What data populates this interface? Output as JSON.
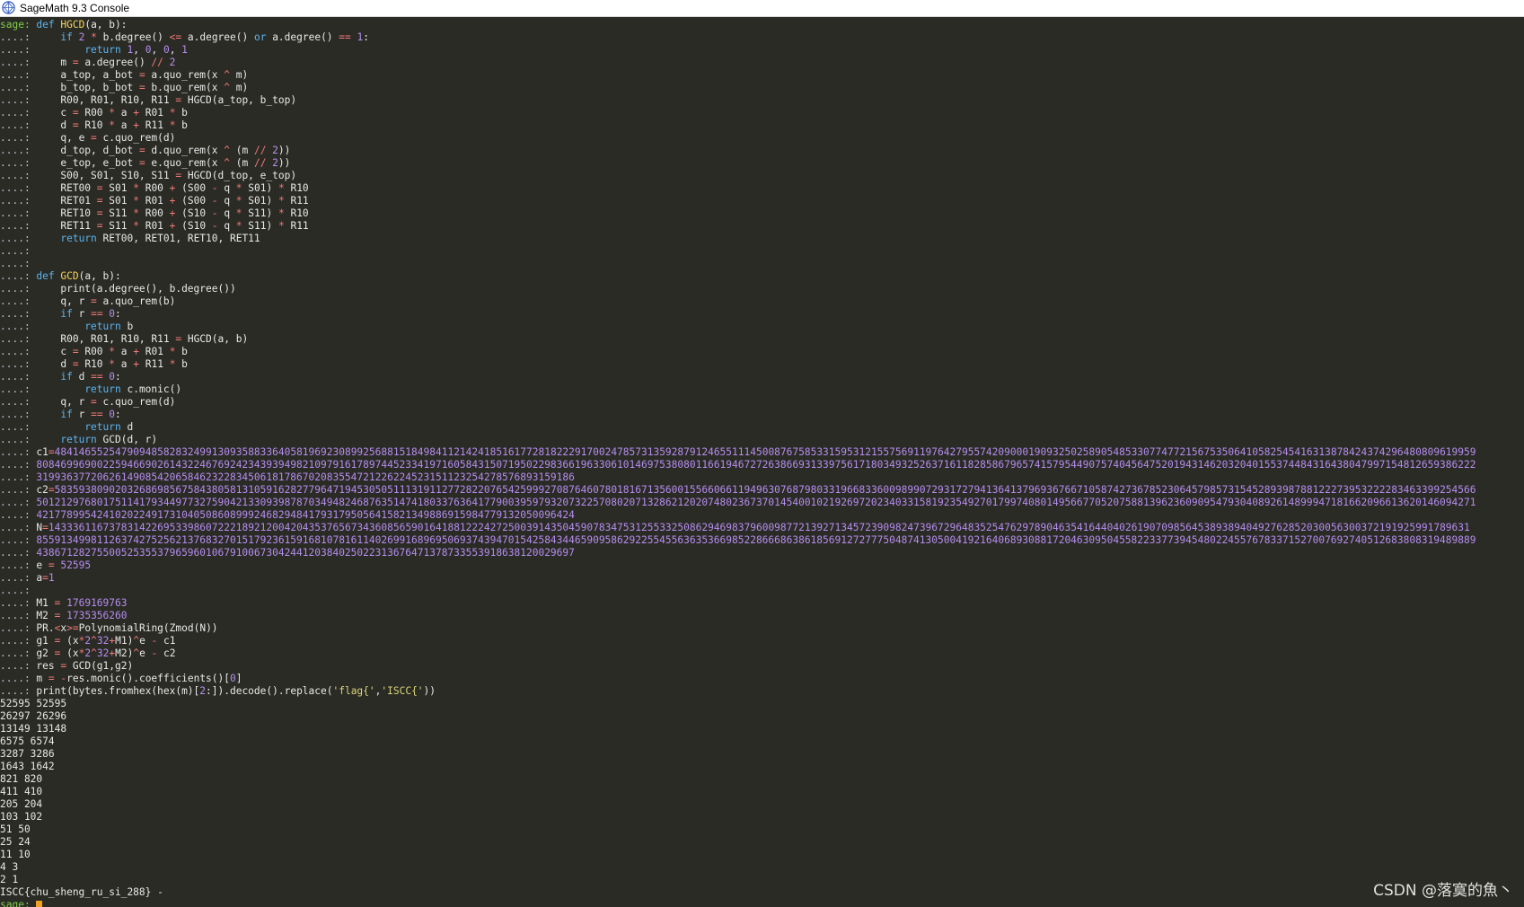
{
  "window": {
    "title": "SageMath 9.3 Console",
    "icon": "sagemath-logo-icon"
  },
  "prompt": {
    "sage": "sage: ",
    "cont": "....: "
  },
  "code_lines": [
    [
      [
        "sp",
        "sage: "
      ],
      [
        "kw",
        "def "
      ],
      [
        "fn",
        "HGCD"
      ],
      [
        "",
        "(a, b):"
      ]
    ],
    [
      [
        "p",
        "....: "
      ],
      [
        "",
        "    "
      ],
      [
        "kw",
        "if "
      ],
      [
        "num",
        "2 "
      ],
      [
        "op",
        "* "
      ],
      [
        "",
        "b.degree() "
      ],
      [
        "op",
        "<= "
      ],
      [
        "",
        "a.degree() "
      ],
      [
        "kw",
        "or "
      ],
      [
        "",
        "a.degree() "
      ],
      [
        "op",
        "== "
      ],
      [
        "num",
        "1"
      ],
      [
        "",
        ":"
      ]
    ],
    [
      [
        "p",
        "....: "
      ],
      [
        "",
        "        "
      ],
      [
        "kw",
        "return "
      ],
      [
        "num",
        "1"
      ],
      [
        "",
        ", "
      ],
      [
        "num",
        "0"
      ],
      [
        "",
        ", "
      ],
      [
        "num",
        "0"
      ],
      [
        "",
        ", "
      ],
      [
        "num",
        "1"
      ]
    ],
    [
      [
        "p",
        "....: "
      ],
      [
        "",
        "    m "
      ],
      [
        "op",
        "= "
      ],
      [
        "",
        "a.degree() "
      ],
      [
        "op",
        "// "
      ],
      [
        "num",
        "2"
      ]
    ],
    [
      [
        "p",
        "....: "
      ],
      [
        "",
        "    a_top, a_bot "
      ],
      [
        "op",
        "= "
      ],
      [
        "",
        "a.quo_rem(x "
      ],
      [
        "op",
        "^ "
      ],
      [
        "",
        "m)"
      ]
    ],
    [
      [
        "p",
        "....: "
      ],
      [
        "",
        "    b_top, b_bot "
      ],
      [
        "op",
        "= "
      ],
      [
        "",
        "b.quo_rem(x "
      ],
      [
        "op",
        "^ "
      ],
      [
        "",
        "m)"
      ]
    ],
    [
      [
        "p",
        "....: "
      ],
      [
        "",
        "    R00, R01, R10, R11 "
      ],
      [
        "op",
        "= "
      ],
      [
        "",
        "HGCD(a_top, b_top)"
      ]
    ],
    [
      [
        "p",
        "....: "
      ],
      [
        "",
        "    c "
      ],
      [
        "op",
        "= "
      ],
      [
        "",
        "R00 "
      ],
      [
        "op",
        "* "
      ],
      [
        "",
        "a "
      ],
      [
        "op",
        "+ "
      ],
      [
        "",
        "R01 "
      ],
      [
        "op",
        "* "
      ],
      [
        "",
        "b"
      ]
    ],
    [
      [
        "p",
        "....: "
      ],
      [
        "",
        "    d "
      ],
      [
        "op",
        "= "
      ],
      [
        "",
        "R10 "
      ],
      [
        "op",
        "* "
      ],
      [
        "",
        "a "
      ],
      [
        "op",
        "+ "
      ],
      [
        "",
        "R11 "
      ],
      [
        "op",
        "* "
      ],
      [
        "",
        "b"
      ]
    ],
    [
      [
        "p",
        "....: "
      ],
      [
        "",
        "    q, e "
      ],
      [
        "op",
        "= "
      ],
      [
        "",
        "c.quo_rem(d)"
      ]
    ],
    [
      [
        "p",
        "....: "
      ],
      [
        "",
        "    d_top, d_bot "
      ],
      [
        "op",
        "= "
      ],
      [
        "",
        "d.quo_rem(x "
      ],
      [
        "op",
        "^ "
      ],
      [
        "",
        "(m "
      ],
      [
        "op",
        "// "
      ],
      [
        "num",
        "2"
      ],
      [
        "",
        "))"
      ]
    ],
    [
      [
        "p",
        "....: "
      ],
      [
        "",
        "    e_top, e_bot "
      ],
      [
        "op",
        "= "
      ],
      [
        "",
        "e.quo_rem(x "
      ],
      [
        "op",
        "^ "
      ],
      [
        "",
        "(m "
      ],
      [
        "op",
        "// "
      ],
      [
        "num",
        "2"
      ],
      [
        "",
        "))"
      ]
    ],
    [
      [
        "p",
        "....: "
      ],
      [
        "",
        "    S00, S01, S10, S11 "
      ],
      [
        "op",
        "= "
      ],
      [
        "",
        "HGCD(d_top, e_top)"
      ]
    ],
    [
      [
        "p",
        "....: "
      ],
      [
        "",
        "    RET00 "
      ],
      [
        "op",
        "= "
      ],
      [
        "",
        "S01 "
      ],
      [
        "op",
        "* "
      ],
      [
        "",
        "R00 "
      ],
      [
        "op",
        "+ "
      ],
      [
        "",
        "(S00 "
      ],
      [
        "op",
        "- "
      ],
      [
        "",
        "q "
      ],
      [
        "op",
        "* "
      ],
      [
        "",
        "S01) "
      ],
      [
        "op",
        "* "
      ],
      [
        "",
        "R10"
      ]
    ],
    [
      [
        "p",
        "....: "
      ],
      [
        "",
        "    RET01 "
      ],
      [
        "op",
        "= "
      ],
      [
        "",
        "S01 "
      ],
      [
        "op",
        "* "
      ],
      [
        "",
        "R01 "
      ],
      [
        "op",
        "+ "
      ],
      [
        "",
        "(S00 "
      ],
      [
        "op",
        "- "
      ],
      [
        "",
        "q "
      ],
      [
        "op",
        "* "
      ],
      [
        "",
        "S01) "
      ],
      [
        "op",
        "* "
      ],
      [
        "",
        "R11"
      ]
    ],
    [
      [
        "p",
        "....: "
      ],
      [
        "",
        "    RET10 "
      ],
      [
        "op",
        "= "
      ],
      [
        "",
        "S11 "
      ],
      [
        "op",
        "* "
      ],
      [
        "",
        "R00 "
      ],
      [
        "op",
        "+ "
      ],
      [
        "",
        "(S10 "
      ],
      [
        "op",
        "- "
      ],
      [
        "",
        "q "
      ],
      [
        "op",
        "* "
      ],
      [
        "",
        "S11) "
      ],
      [
        "op",
        "* "
      ],
      [
        "",
        "R10"
      ]
    ],
    [
      [
        "p",
        "....: "
      ],
      [
        "",
        "    RET11 "
      ],
      [
        "op",
        "= "
      ],
      [
        "",
        "S11 "
      ],
      [
        "op",
        "* "
      ],
      [
        "",
        "R01 "
      ],
      [
        "op",
        "+ "
      ],
      [
        "",
        "(S10 "
      ],
      [
        "op",
        "- "
      ],
      [
        "",
        "q "
      ],
      [
        "op",
        "* "
      ],
      [
        "",
        "S11) "
      ],
      [
        "op",
        "* "
      ],
      [
        "",
        "R11"
      ]
    ],
    [
      [
        "p",
        "....: "
      ],
      [
        "",
        "    "
      ],
      [
        "kw",
        "return "
      ],
      [
        "",
        "RET00, RET01, RET10, RET11"
      ]
    ],
    [
      [
        "p",
        "....: "
      ]
    ],
    [
      [
        "p",
        "....: "
      ]
    ],
    [
      [
        "p",
        "....: "
      ],
      [
        "kw",
        "def "
      ],
      [
        "fn",
        "GCD"
      ],
      [
        "",
        "(a, b):"
      ]
    ],
    [
      [
        "p",
        "....: "
      ],
      [
        "",
        "    print(a.degree(), b.degree())"
      ]
    ],
    [
      [
        "p",
        "....: "
      ],
      [
        "",
        "    q, r "
      ],
      [
        "op",
        "= "
      ],
      [
        "",
        "a.quo_rem(b)"
      ]
    ],
    [
      [
        "p",
        "....: "
      ],
      [
        "",
        "    "
      ],
      [
        "kw",
        "if "
      ],
      [
        "",
        "r "
      ],
      [
        "op",
        "== "
      ],
      [
        "num",
        "0"
      ],
      [
        "",
        ":"
      ]
    ],
    [
      [
        "p",
        "....: "
      ],
      [
        "",
        "        "
      ],
      [
        "kw",
        "return "
      ],
      [
        "",
        "b"
      ]
    ],
    [
      [
        "p",
        "....: "
      ],
      [
        "",
        "    R00, R01, R10, R11 "
      ],
      [
        "op",
        "= "
      ],
      [
        "",
        "HGCD(a, b)"
      ]
    ],
    [
      [
        "p",
        "....: "
      ],
      [
        "",
        "    c "
      ],
      [
        "op",
        "= "
      ],
      [
        "",
        "R00 "
      ],
      [
        "op",
        "* "
      ],
      [
        "",
        "a "
      ],
      [
        "op",
        "+ "
      ],
      [
        "",
        "R01 "
      ],
      [
        "op",
        "* "
      ],
      [
        "",
        "b"
      ]
    ],
    [
      [
        "p",
        "....: "
      ],
      [
        "",
        "    d "
      ],
      [
        "op",
        "= "
      ],
      [
        "",
        "R10 "
      ],
      [
        "op",
        "* "
      ],
      [
        "",
        "a "
      ],
      [
        "op",
        "+ "
      ],
      [
        "",
        "R11 "
      ],
      [
        "op",
        "* "
      ],
      [
        "",
        "b"
      ]
    ],
    [
      [
        "p",
        "....: "
      ],
      [
        "",
        "    "
      ],
      [
        "kw",
        "if "
      ],
      [
        "",
        "d "
      ],
      [
        "op",
        "== "
      ],
      [
        "num",
        "0"
      ],
      [
        "",
        ":"
      ]
    ],
    [
      [
        "p",
        "....: "
      ],
      [
        "",
        "        "
      ],
      [
        "kw",
        "return "
      ],
      [
        "",
        "c.monic()"
      ]
    ],
    [
      [
        "p",
        "....: "
      ],
      [
        "",
        "    q, r "
      ],
      [
        "op",
        "= "
      ],
      [
        "",
        "c.quo_rem(d)"
      ]
    ],
    [
      [
        "p",
        "....: "
      ],
      [
        "",
        "    "
      ],
      [
        "kw",
        "if "
      ],
      [
        "",
        "r "
      ],
      [
        "op",
        "== "
      ],
      [
        "num",
        "0"
      ],
      [
        "",
        ":"
      ]
    ],
    [
      [
        "p",
        "....: "
      ],
      [
        "",
        "        "
      ],
      [
        "kw",
        "return "
      ],
      [
        "",
        "d"
      ]
    ],
    [
      [
        "p",
        "....: "
      ],
      [
        "",
        "    "
      ],
      [
        "kw",
        "return "
      ],
      [
        "",
        "GCD(d, r)"
      ]
    ],
    [
      [
        "p",
        "....: "
      ],
      [
        "",
        "c1"
      ],
      [
        "op",
        "="
      ],
      [
        "num",
        "4841465525479094858283249913093588336405819692308992568815184984112142418516177281822291700247857313592879124655111450087675853315953121557569119764279557420900019093250258905485330774772156753506410582545416313878424374296480809619959"
      ]
    ],
    [
      [
        "p",
        "....: "
      ],
      [
        "num",
        "8084699690022594669026143224676924234393949821097916178974452334197160584315071950229836619633061014697538080116619467272638669313397561718034932526371611828586796574157954490757404564752019431462032040155374484316438047997154812659386222"
      ]
    ],
    [
      [
        "p",
        "....: "
      ],
      [
        "num",
        "31993637720626149085420658462322834506181786702083554721226224523151123254278576893159186"
      ]
    ],
    [
      [
        "p",
        "....: "
      ],
      [
        "",
        "c2"
      ],
      [
        "op",
        "="
      ],
      [
        "num",
        "5835938090203268698567584380581310591628277964719453050511131911277282207654259992708764607801816713560015566066119496307687980331966833600989907293172794136413796936766710587427367852306457985731545289398788122273953222283463399254566"
      ]
    ],
    [
      [
        "p",
        "....: "
      ],
      [
        "num",
        "5012129768017511417934497732759042133093987870349482468763514741803376364177900395979320732257080207132862120207480236737014540010219269720234033158192354927017997408014956677052075881396236090954793040892614899947181662096613620146094271"
      ]
    ],
    [
      [
        "p",
        "....: "
      ],
      [
        "num",
        "42177899542410202249173104050860899924682948417931795056415821349886915984779132050096424"
      ]
    ],
    [
      [
        "p",
        "....: "
      ],
      [
        "",
        "N"
      ],
      [
        "op",
        "="
      ],
      [
        "num",
        "1433361167378314226953398607222189212004204353765673436085659016418812224272500391435045907834753125533250862946983796009877213927134572390982473967296483525476297890463541644040261907098564538938940492762852030056300372191925991789631"
      ]
    ],
    [
      [
        "p",
        "....: "
      ],
      [
        "num",
        "8559134998112637427525621376832701517923615916810781611402699168969506937439470154258434465909586292255455636353669852286668638618569127277750487413050041921640689308817204630950455822337739454802245576783371527007692740512683808319489889"
      ]
    ],
    [
      [
        "p",
        "....: "
      ],
      [
        "num",
        "4386712827550052535537965960106791006730424412038402502231367647137873355391863812002969​7"
      ]
    ],
    [
      [
        "p",
        "....: "
      ],
      [
        "",
        "e "
      ],
      [
        "op",
        "= "
      ],
      [
        "num",
        "52595"
      ]
    ],
    [
      [
        "p",
        "....: "
      ],
      [
        "",
        "a"
      ],
      [
        "op",
        "="
      ],
      [
        "num",
        "1"
      ]
    ],
    [
      [
        "p",
        "....: "
      ]
    ],
    [
      [
        "p",
        "....: "
      ],
      [
        "",
        "M1 "
      ],
      [
        "op",
        "= "
      ],
      [
        "num",
        "1769169763"
      ]
    ],
    [
      [
        "p",
        "....: "
      ],
      [
        "",
        "M2 "
      ],
      [
        "op",
        "= "
      ],
      [
        "num",
        "1735356260"
      ]
    ],
    [
      [
        "p",
        "....: "
      ],
      [
        "",
        "PR."
      ],
      [
        "op",
        "<"
      ],
      [
        "",
        "x"
      ],
      [
        "op",
        ">="
      ],
      [
        "",
        "PolynomialRing(Zmod(N))"
      ]
    ],
    [
      [
        "p",
        "....: "
      ],
      [
        "",
        "g1 "
      ],
      [
        "op",
        "= "
      ],
      [
        "",
        "(x"
      ],
      [
        "op",
        "*"
      ],
      [
        "num",
        "2"
      ],
      [
        "op",
        "^"
      ],
      [
        "num",
        "32"
      ],
      [
        "op",
        "+"
      ],
      [
        "",
        "M1)"
      ],
      [
        "op",
        "^"
      ],
      [
        "",
        "e "
      ],
      [
        "op",
        "- "
      ],
      [
        "",
        "c1"
      ]
    ],
    [
      [
        "p",
        "....: "
      ],
      [
        "",
        "g2 "
      ],
      [
        "op",
        "= "
      ],
      [
        "",
        "(x"
      ],
      [
        "op",
        "*"
      ],
      [
        "num",
        "2"
      ],
      [
        "op",
        "^"
      ],
      [
        "num",
        "32"
      ],
      [
        "op",
        "+"
      ],
      [
        "",
        "M2)"
      ],
      [
        "op",
        "^"
      ],
      [
        "",
        "e "
      ],
      [
        "op",
        "- "
      ],
      [
        "",
        "c2"
      ]
    ],
    [
      [
        "p",
        "....: "
      ],
      [
        "",
        "res "
      ],
      [
        "op",
        "= "
      ],
      [
        "",
        "GCD(g1,g2)"
      ]
    ],
    [
      [
        "p",
        "....: "
      ],
      [
        "",
        "m "
      ],
      [
        "op",
        "= "
      ],
      [
        "op",
        "-"
      ],
      [
        "",
        "res.monic().coefficients()["
      ],
      [
        "num",
        "0"
      ],
      [
        "",
        "]"
      ]
    ],
    [
      [
        "p",
        "....: "
      ],
      [
        "",
        "print(bytes.fromhex(hex(m)["
      ],
      [
        "num",
        "2"
      ],
      [
        "",
        ":]).decode().replace("
      ],
      [
        "str",
        "'flag{'"
      ],
      [
        "",
        ","
      ],
      [
        "str",
        "'ISCC{'"
      ],
      [
        "",
        "))"
      ]
    ]
  ],
  "output_lines": [
    "52595 52595",
    "26297 26296",
    "13149 13148",
    "6575 6574",
    "3287 3286",
    "1643 1642",
    "821 820",
    "411 410",
    "205 204",
    "103 102",
    "51 50",
    "25 24",
    "11 10",
    "4 3",
    "2 1",
    "ISCC{chu_sheng_ru_si_288} -"
  ],
  "final_prompt": "sage: ",
  "watermark": "CSDN @落寞的魚丶"
}
